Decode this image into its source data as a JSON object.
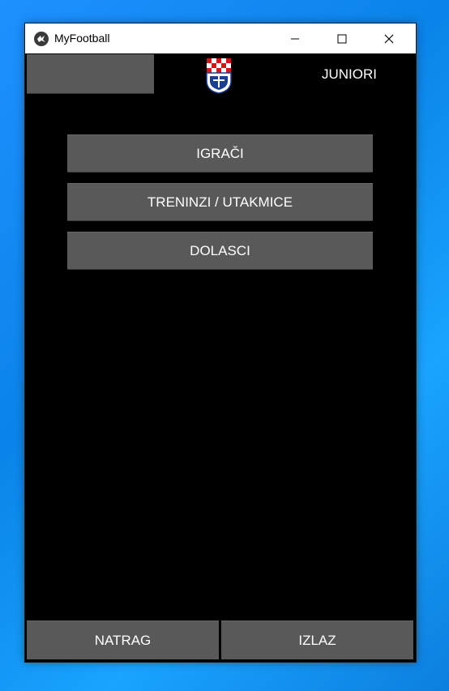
{
  "window": {
    "title": "MyFootball",
    "icons": {
      "app": "kivy-logo-icon",
      "minimize": "minimize-icon",
      "maximize": "maximize-icon",
      "close": "close-icon"
    }
  },
  "header": {
    "section_title": "JUNIORI",
    "logo": "club-crest-logo"
  },
  "menu": {
    "items": [
      {
        "label": "IGRAČI"
      },
      {
        "label": "TRENINZI / UTAKMICE"
      },
      {
        "label": "DOLASCI"
      }
    ]
  },
  "footer": {
    "back_label": "NATRAG",
    "exit_label": "IZLAZ"
  },
  "colors": {
    "button_bg": "#595959",
    "app_bg": "#000000",
    "desktop": "#0a84e8",
    "crest_red": "#d7141a",
    "crest_blue": "#1b3f8f"
  }
}
